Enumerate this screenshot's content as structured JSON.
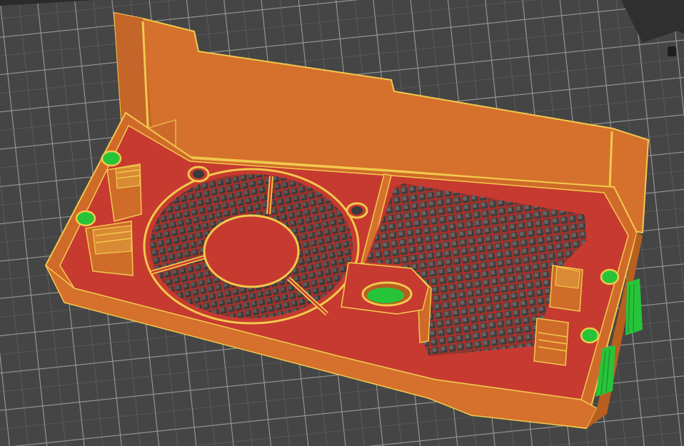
{
  "viewer": {
    "name": "slicer-preview-viewport",
    "colors": {
      "background": "#2b2b2b",
      "bed_top": "#434343",
      "bed_side": "#3a3a3a",
      "grid_line": "#a8a8a8",
      "perimeter_orange": "#d9722a",
      "wall_orange_dark": "#b85f20",
      "infill_red": "#c73a30",
      "sparse_infill": "#a3322b",
      "support_green": "#27c43a",
      "outline_yellow": "#f2c94c"
    },
    "legend": [
      {
        "feature": "perimeter",
        "color_key": "perimeter_orange"
      },
      {
        "feature": "solid-infill",
        "color_key": "infill_red"
      },
      {
        "feature": "sparse-infill",
        "color_key": "sparse_infill"
      },
      {
        "feature": "support-material",
        "color_key": "support_green"
      }
    ]
  }
}
